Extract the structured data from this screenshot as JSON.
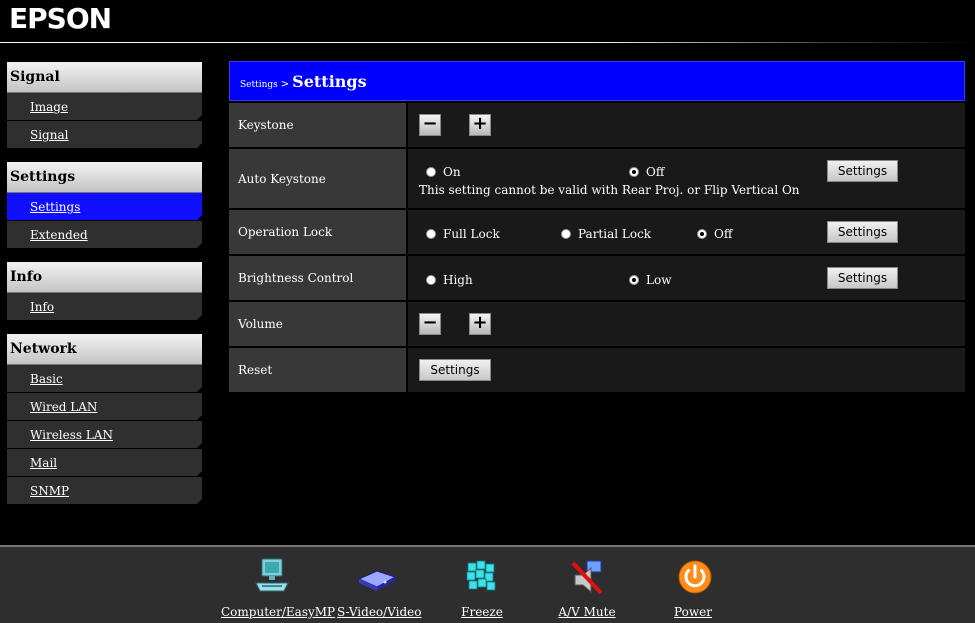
{
  "brand": "EPSON",
  "sidebar": {
    "groups": [
      {
        "title": "Signal",
        "items": [
          {
            "label": "Image"
          },
          {
            "label": "Signal"
          }
        ]
      },
      {
        "title": "Settings",
        "items": [
          {
            "label": "Settings",
            "active": true
          },
          {
            "label": "Extended"
          }
        ]
      },
      {
        "title": "Info",
        "items": [
          {
            "label": "Info"
          }
        ]
      },
      {
        "title": "Network",
        "items": [
          {
            "label": "Basic"
          },
          {
            "label": "Wired LAN"
          },
          {
            "label": "Wireless LAN"
          },
          {
            "label": "Mail"
          },
          {
            "label": "SNMP"
          }
        ]
      }
    ]
  },
  "main": {
    "breadcrumb": "Settings",
    "breadcrumb_sep": ">",
    "title": "Settings",
    "rows": {
      "keystone": {
        "label": "Keystone",
        "minus": "−",
        "plus": "+"
      },
      "auto_keystone": {
        "label": "Auto Keystone",
        "options": [
          "On",
          "Off"
        ],
        "selected": "Off",
        "button": "Settings",
        "note": "This setting cannot be valid with Rear Proj. or Flip Vertical On"
      },
      "operation_lock": {
        "label": "Operation Lock",
        "options": [
          "Full Lock",
          "Partial Lock",
          "Off"
        ],
        "selected": "Off",
        "button": "Settings"
      },
      "brightness": {
        "label": "Brightness Control",
        "options": [
          "High",
          "Low"
        ],
        "selected": "Low",
        "button": "Settings"
      },
      "volume": {
        "label": "Volume",
        "minus": "−",
        "plus": "+"
      },
      "reset": {
        "label": "Reset",
        "button": "Settings"
      }
    }
  },
  "footer": {
    "buttons": [
      {
        "label": "Computer/EasyMP",
        "icon": "computer-icon"
      },
      {
        "label": "S-Video/Video",
        "icon": "video-device-icon"
      },
      {
        "label": "Freeze",
        "icon": "freeze-icon"
      },
      {
        "label": "A/V Mute",
        "icon": "av-mute-icon"
      },
      {
        "label": "Power",
        "icon": "power-icon"
      }
    ]
  },
  "colors": {
    "title_bar": "#0000ff",
    "active_nav": "#1010ff",
    "power": "#ff8c1a"
  }
}
